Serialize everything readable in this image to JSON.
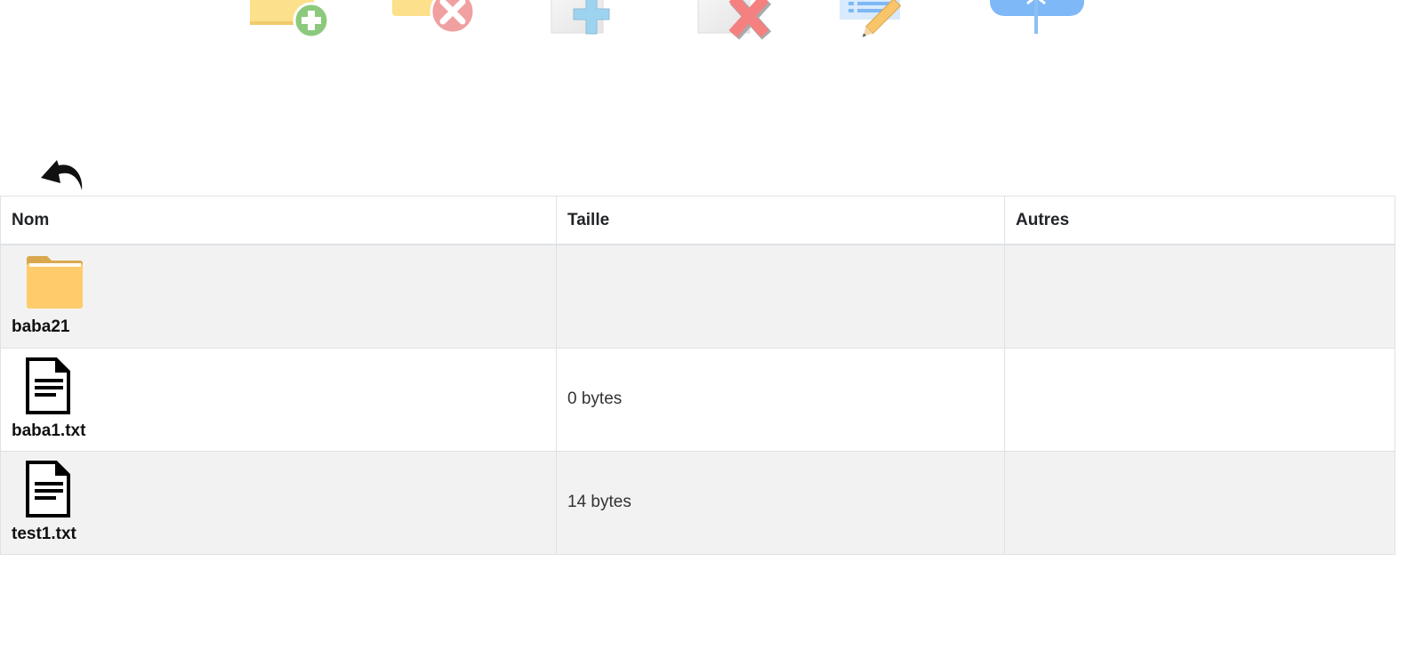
{
  "toolbar": {
    "tools": [
      {
        "name": "add-folder-icon"
      },
      {
        "name": "delete-folder-icon"
      },
      {
        "name": "add-file-icon"
      },
      {
        "name": "delete-file-icon"
      },
      {
        "name": "edit-file-icon"
      },
      {
        "name": "upload-icon"
      }
    ]
  },
  "back_icon": "back-arrow-icon",
  "table": {
    "headers": {
      "name": "Nom",
      "size": "Taille",
      "other": "Autres"
    },
    "rows": [
      {
        "icon": "folder-icon",
        "name": "baba21",
        "size": "",
        "other": ""
      },
      {
        "icon": "text-file-icon",
        "name": "baba1.txt",
        "size": "0 bytes",
        "other": ""
      },
      {
        "icon": "text-file-icon",
        "name": "test1.txt",
        "size": "14 bytes",
        "other": ""
      }
    ]
  },
  "colors": {
    "folder": "#FFCB6B",
    "folder_dark": "#D9A84E",
    "add_green": "#8CC97D",
    "delete_red": "#F08A8A",
    "plus_blue": "#9ED3F0",
    "upload_blue": "#7EB8F7",
    "pencil_orange": "#F8C56B",
    "row_stripe": "#F2F2F2",
    "border": "#DEE2E6"
  }
}
